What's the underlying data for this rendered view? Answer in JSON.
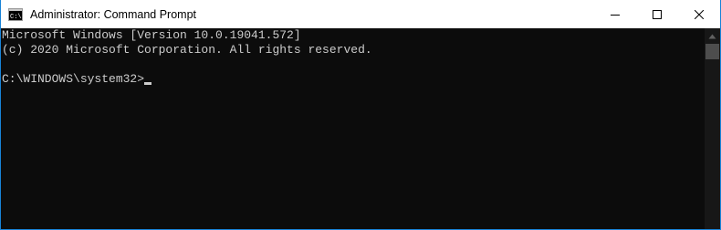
{
  "window": {
    "title": "Administrator: Command Prompt",
    "icon": "cmd-icon",
    "accent_color": "#1883d7"
  },
  "caption_buttons": {
    "minimize_icon": "minimize-icon",
    "maximize_icon": "maximize-icon",
    "close_icon": "close-icon"
  },
  "console": {
    "lines": [
      "Microsoft Windows [Version 10.0.19041.572]",
      "(c) 2020 Microsoft Corporation. All rights reserved.",
      ""
    ],
    "prompt": "C:\\WINDOWS\\system32>",
    "background_color": "#0c0c0c",
    "text_color": "#cccccc"
  },
  "scrollbar": {
    "up_icon": "scroll-up-arrow-icon"
  }
}
